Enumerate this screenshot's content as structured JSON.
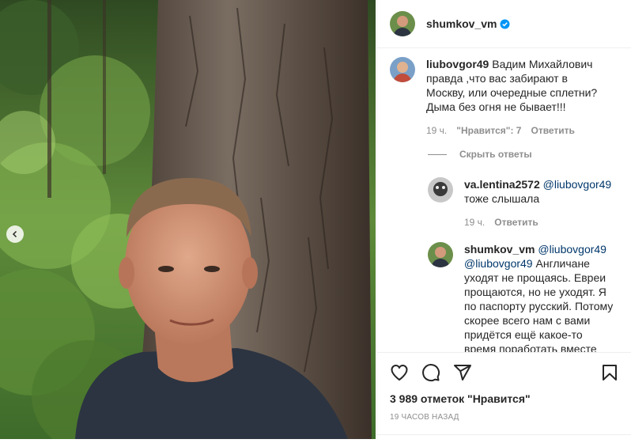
{
  "post": {
    "author": "shumkov_vm",
    "verified": true
  },
  "comments": [
    {
      "username": "liubovgor49",
      "text": "Вадим Михайлович правда ,что вас забирают в Москву, или очередные сплетни? Дыма без огня не бывает!!!",
      "time": "19 ч.",
      "likes": "\"Нравится\": 7",
      "reply_label": "Ответить",
      "hide_replies_label": "Скрыть ответы",
      "replies": [
        {
          "username": "va.lentina2572",
          "mention": "@liubovgor49",
          "text": "тоже слышала",
          "time": "19 ч.",
          "reply_label": "Ответить"
        },
        {
          "username": "shumkov_vm",
          "mention": "@liubovgor49",
          "mention2": "@liubovgor49",
          "text": "Англичане уходят не прощаясь. Евреи прощаются, но не уходят. Я по паспорту русский. Потому скорее всего нам с вами придётся ещё какое-то время поработать вместе"
        }
      ]
    }
  ],
  "likes_count": "3 989 отметок \"Нравится\"",
  "timestamp": "19 ЧАСОВ НАЗАД",
  "icons": {
    "like": "heart-icon",
    "comment": "comment-icon",
    "share": "share-icon",
    "save": "bookmark-icon",
    "prev": "chevron-left-icon",
    "verified": "verified-badge-icon"
  },
  "colors": {
    "verified": "#0095f6",
    "mention": "#00376b",
    "secondary": "#8e8e8e",
    "text": "#262626"
  }
}
